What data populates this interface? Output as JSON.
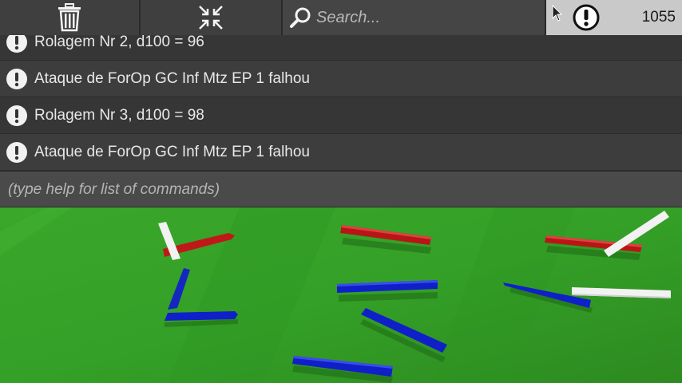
{
  "toolbar": {
    "trash_icon": "trash-icon",
    "collapse_icon": "collapse-icon",
    "search_icon": "search-icon",
    "search_placeholder": "Search...",
    "alert_icon": "alert-icon",
    "counter": "1055"
  },
  "log": {
    "messages": [
      {
        "icon": "alert-icon",
        "text": "Rolagem Nr 2, d100 = 96"
      },
      {
        "icon": "alert-icon",
        "text": "Ataque de ForOp GC Inf Mtz EP 1 falhou"
      },
      {
        "icon": "alert-icon",
        "text": "Rolagem Nr 3, d100 = 98"
      },
      {
        "icon": "alert-icon",
        "text": "Ataque de ForOp GC Inf Mtz EP 1 falhou"
      }
    ]
  },
  "command": {
    "placeholder": "(type help for list of commands)"
  },
  "colors": {
    "field": "#3a9a2a",
    "red_unit": "#c01818",
    "blue_unit": "#1020c8",
    "white_unit": "#f2f2f2"
  }
}
